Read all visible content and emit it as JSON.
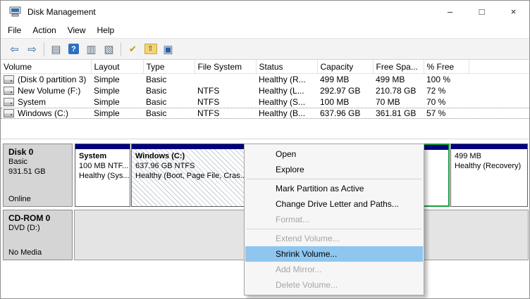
{
  "titlebar": {
    "title": "Disk Management",
    "controls": {
      "minimize": "–",
      "maximize": "□",
      "close": "×"
    }
  },
  "menubar": {
    "items": [
      "File",
      "Action",
      "View",
      "Help"
    ]
  },
  "toolbar": {
    "icons": [
      {
        "name": "back",
        "glyph": "⇦"
      },
      {
        "name": "forward",
        "glyph": "⇨"
      },
      {
        "name": "show-console-tree",
        "glyph": "▤"
      },
      {
        "name": "help",
        "glyph": "?"
      },
      {
        "name": "show-action-pane",
        "glyph": "▥"
      },
      {
        "name": "dialog",
        "glyph": "▧"
      },
      {
        "name": "mark-check",
        "glyph": "✔"
      },
      {
        "name": "folder-up",
        "glyph": "⇧"
      },
      {
        "name": "screen",
        "glyph": "▣"
      }
    ]
  },
  "volume_table": {
    "columns": [
      "Volume",
      "Layout",
      "Type",
      "File System",
      "Status",
      "Capacity",
      "Free Spa...",
      "% Free"
    ],
    "rows": [
      {
        "volume": "(Disk 0 partition 3)",
        "layout": "Simple",
        "type": "Basic",
        "file_system": "",
        "status": "Healthy (R...",
        "capacity": "499 MB",
        "free_space": "499 MB",
        "pct_free": "100 %"
      },
      {
        "volume": "New Volume (F:)",
        "layout": "Simple",
        "type": "Basic",
        "file_system": "NTFS",
        "status": "Healthy (L...",
        "capacity": "292.97 GB",
        "free_space": "210.78 GB",
        "pct_free": "72 %"
      },
      {
        "volume": "System",
        "layout": "Simple",
        "type": "Basic",
        "file_system": "NTFS",
        "status": "Healthy (S...",
        "capacity": "100 MB",
        "free_space": "70 MB",
        "pct_free": "70 %"
      },
      {
        "volume": "Windows (C:)",
        "layout": "Simple",
        "type": "Basic",
        "file_system": "NTFS",
        "status": "Healthy (B...",
        "capacity": "637.96 GB",
        "free_space": "361.81 GB",
        "pct_free": "57 %"
      }
    ]
  },
  "disks": {
    "disk0": {
      "name": "Disk 0",
      "kind": "Basic",
      "size": "931.51 GB",
      "status": "Online",
      "partitions": {
        "system": {
          "line1": "System",
          "line2": "100 MB NTF...",
          "line3": "Healthy (Sys..."
        },
        "windows": {
          "line1": "Windows (C:)",
          "line2": "637.96 GB NTFS",
          "line3": "Healthy (Boot, Page File, Cras..."
        },
        "recovery": {
          "line1": "499 MB",
          "line2": "Healthy (Recovery)"
        }
      }
    },
    "cdrom": {
      "name": "CD-ROM 0",
      "kind": "DVD (D:)",
      "status": "No Media"
    }
  },
  "context_menu": {
    "items": [
      {
        "label": "Open",
        "state": "enabled"
      },
      {
        "label": "Explore",
        "state": "enabled"
      },
      {
        "label": "Mark Partition as Active",
        "state": "enabled"
      },
      {
        "label": "Change Drive Letter and Paths...",
        "state": "enabled"
      },
      {
        "label": "Format...",
        "state": "disabled"
      },
      {
        "label": "Extend Volume...",
        "state": "disabled"
      },
      {
        "label": "Shrink Volume...",
        "state": "highlighted"
      },
      {
        "label": "Add Mirror...",
        "state": "disabled"
      },
      {
        "label": "Delete Volume...",
        "state": "disabled"
      }
    ]
  },
  "colors": {
    "partition_stripe": "#000080",
    "extended_border": "#13a03c",
    "menu_highlight": "#8ec6f0"
  }
}
